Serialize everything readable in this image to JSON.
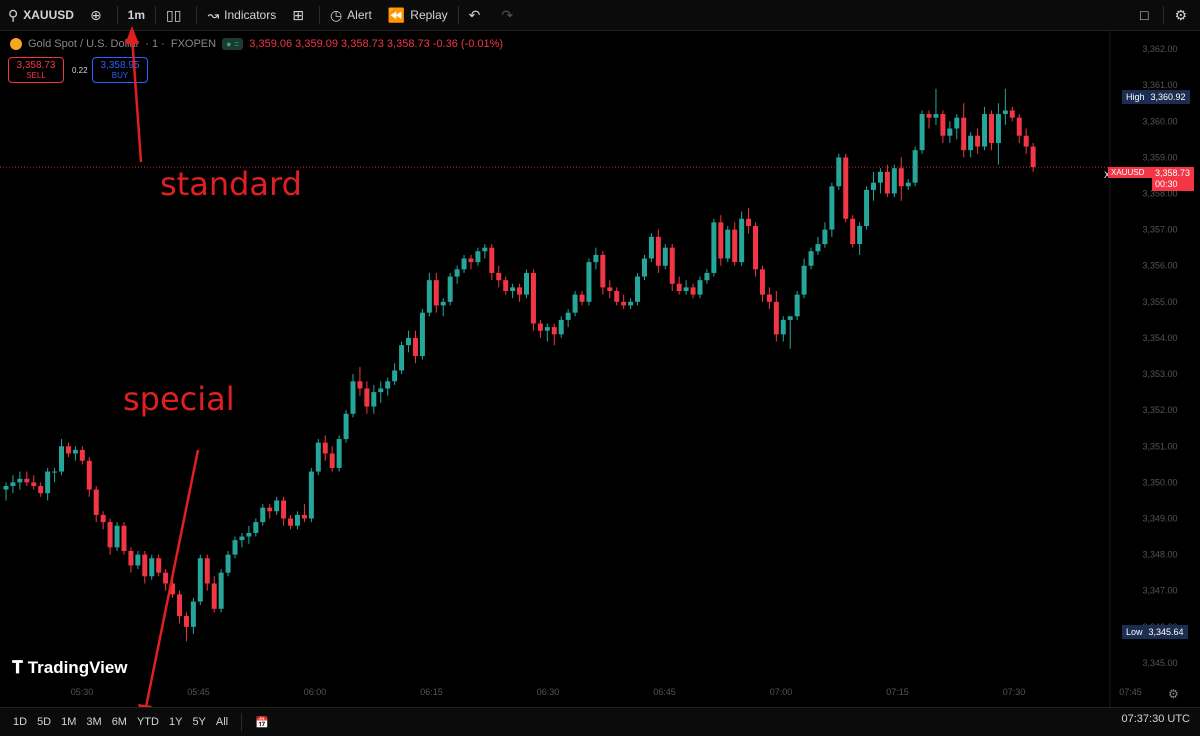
{
  "toolbar": {
    "symbol": "XAUUSD",
    "interval": "1m",
    "indicators": "Indicators",
    "alert": "Alert",
    "replay": "Replay"
  },
  "legend": {
    "title": "Gold Spot / U.S. Dollar",
    "separator": "· 1 ·",
    "broker": "FXOPEN",
    "ohlc": "3,359.06  3,359.09  3,358.73  3,358.73  -0.36 (-0.01%)"
  },
  "trade": {
    "sell_price": "3,358.73",
    "sell_label": "SELL",
    "spread": "0.22",
    "buy_price": "3,358.95",
    "buy_label": "BUY"
  },
  "price_labels": {
    "high_label": "High",
    "high_value": "3,360.92",
    "low_label": "Low",
    "low_value": "3,345.64",
    "symbol": "XAUUSD",
    "current": "3,358.73",
    "countdown": "00:30"
  },
  "annotations": {
    "standard": "standard",
    "special": "special"
  },
  "brand": "TradingView",
  "ranges": [
    "1D",
    "5D",
    "1M",
    "3M",
    "6M",
    "YTD",
    "1Y",
    "5Y",
    "All"
  ],
  "time_display": "07:37:30 UTC",
  "colors": {
    "up": "#26a69a",
    "down": "#f23645",
    "background": "#000000",
    "annotation": "#e02020"
  },
  "chart_data": {
    "type": "candlestick",
    "ylim": [
      3344.5,
      3362.5
    ],
    "y_ticks": [
      "3,362.00",
      "3,361.00",
      "3,360.00",
      "3,359.00",
      "3,358.00",
      "3,357.00",
      "3,356.00",
      "3,355.00",
      "3,354.00",
      "3,353.00",
      "3,352.00",
      "3,351.00",
      "3,350.00",
      "3,349.00",
      "3,348.00",
      "3,347.00",
      "3,346.00",
      "3,345.00"
    ],
    "y_tick_values": [
      3362,
      3361,
      3360,
      3359,
      3358,
      3357,
      3356,
      3355,
      3354,
      3353,
      3352,
      3351,
      3350,
      3349,
      3348,
      3347,
      3346,
      3345
    ],
    "x_ticks": [
      "05:30",
      "05:45",
      "06:00",
      "06:15",
      "06:30",
      "06:45",
      "07:00",
      "07:15",
      "07:30",
      "07:45"
    ],
    "current_price": 3358.73,
    "candles": [
      [
        3349.8,
        3350.0,
        3349.5,
        3349.9
      ],
      [
        3349.9,
        3350.2,
        3349.7,
        3350.0
      ],
      [
        3350.0,
        3350.3,
        3349.8,
        3350.1
      ],
      [
        3350.1,
        3350.3,
        3349.9,
        3350.0
      ],
      [
        3350.0,
        3350.2,
        3349.8,
        3349.9
      ],
      [
        3349.9,
        3350.0,
        3349.6,
        3349.7
      ],
      [
        3349.7,
        3350.4,
        3349.5,
        3350.3
      ],
      [
        3350.3,
        3350.4,
        3350.0,
        3350.3
      ],
      [
        3350.3,
        3351.2,
        3350.2,
        3351.0
      ],
      [
        3351.0,
        3351.1,
        3350.7,
        3350.8
      ],
      [
        3350.8,
        3351.0,
        3350.6,
        3350.9
      ],
      [
        3350.9,
        3351.0,
        3350.5,
        3350.6
      ],
      [
        3350.6,
        3350.7,
        3349.6,
        3349.8
      ],
      [
        3349.8,
        3349.9,
        3348.9,
        3349.1
      ],
      [
        3349.1,
        3349.2,
        3348.7,
        3348.9
      ],
      [
        3348.9,
        3349.0,
        3348.0,
        3348.2
      ],
      [
        3348.2,
        3348.9,
        3348.1,
        3348.8
      ],
      [
        3348.8,
        3348.9,
        3348.0,
        3348.1
      ],
      [
        3348.1,
        3348.2,
        3347.5,
        3347.7
      ],
      [
        3347.7,
        3348.1,
        3347.6,
        3348.0
      ],
      [
        3348.0,
        3348.1,
        3347.2,
        3347.4
      ],
      [
        3347.4,
        3348.0,
        3347.3,
        3347.9
      ],
      [
        3347.9,
        3348.0,
        3347.4,
        3347.5
      ],
      [
        3347.5,
        3347.6,
        3347.0,
        3347.2
      ],
      [
        3347.2,
        3347.4,
        3346.8,
        3346.9
      ],
      [
        3346.9,
        3347.0,
        3346.1,
        3346.3
      ],
      [
        3346.3,
        3346.4,
        3345.6,
        3346.0
      ],
      [
        3346.0,
        3346.8,
        3345.8,
        3346.7
      ],
      [
        3346.7,
        3348.0,
        3346.6,
        3347.9
      ],
      [
        3347.9,
        3348.0,
        3347.0,
        3347.2
      ],
      [
        3347.2,
        3347.4,
        3346.4,
        3346.5
      ],
      [
        3346.5,
        3347.6,
        3346.4,
        3347.5
      ],
      [
        3347.5,
        3348.1,
        3347.4,
        3348.0
      ],
      [
        3348.0,
        3348.5,
        3347.9,
        3348.4
      ],
      [
        3348.4,
        3348.6,
        3348.2,
        3348.5
      ],
      [
        3348.5,
        3348.8,
        3348.3,
        3348.6
      ],
      [
        3348.6,
        3349.0,
        3348.5,
        3348.9
      ],
      [
        3348.9,
        3349.4,
        3348.8,
        3349.3
      ],
      [
        3349.3,
        3349.4,
        3349.0,
        3349.2
      ],
      [
        3349.2,
        3349.6,
        3349.1,
        3349.5
      ],
      [
        3349.5,
        3349.6,
        3348.8,
        3349.0
      ],
      [
        3349.0,
        3349.1,
        3348.7,
        3348.8
      ],
      [
        3348.8,
        3349.2,
        3348.7,
        3349.1
      ],
      [
        3349.1,
        3349.4,
        3348.9,
        3349.0
      ],
      [
        3349.0,
        3350.4,
        3348.9,
        3350.3
      ],
      [
        3350.3,
        3351.2,
        3350.2,
        3351.1
      ],
      [
        3351.1,
        3351.3,
        3350.6,
        3350.8
      ],
      [
        3350.8,
        3351.0,
        3350.3,
        3350.4
      ],
      [
        3350.4,
        3351.3,
        3350.3,
        3351.2
      ],
      [
        3351.2,
        3352.0,
        3351.1,
        3351.9
      ],
      [
        3351.9,
        3353.0,
        3351.8,
        3352.8
      ],
      [
        3352.8,
        3353.2,
        3352.4,
        3352.6
      ],
      [
        3352.6,
        3352.8,
        3351.9,
        3352.1
      ],
      [
        3352.1,
        3352.7,
        3351.9,
        3352.5
      ],
      [
        3352.5,
        3352.8,
        3352.2,
        3352.6
      ],
      [
        3352.6,
        3352.9,
        3352.4,
        3352.8
      ],
      [
        3352.8,
        3353.3,
        3352.7,
        3353.1
      ],
      [
        3353.1,
        3353.9,
        3353.0,
        3353.8
      ],
      [
        3353.8,
        3354.2,
        3353.6,
        3354.0
      ],
      [
        3354.0,
        3354.2,
        3353.3,
        3353.5
      ],
      [
        3353.5,
        3354.8,
        3353.4,
        3354.7
      ],
      [
        3354.7,
        3355.8,
        3354.6,
        3355.6
      ],
      [
        3355.6,
        3355.8,
        3354.7,
        3354.9
      ],
      [
        3354.9,
        3355.1,
        3354.6,
        3355.0
      ],
      [
        3355.0,
        3355.8,
        3354.9,
        3355.7
      ],
      [
        3355.7,
        3356.0,
        3355.5,
        3355.9
      ],
      [
        3355.9,
        3356.3,
        3355.8,
        3356.2
      ],
      [
        3356.2,
        3356.3,
        3355.9,
        3356.1
      ],
      [
        3356.1,
        3356.5,
        3356.0,
        3356.4
      ],
      [
        3356.4,
        3356.6,
        3356.2,
        3356.5
      ],
      [
        3356.5,
        3356.6,
        3355.6,
        3355.8
      ],
      [
        3355.8,
        3356.0,
        3355.4,
        3355.6
      ],
      [
        3355.6,
        3355.7,
        3355.2,
        3355.3
      ],
      [
        3355.3,
        3355.5,
        3355.1,
        3355.4
      ],
      [
        3355.4,
        3355.5,
        3355.0,
        3355.2
      ],
      [
        3355.2,
        3355.9,
        3355.1,
        3355.8
      ],
      [
        3355.8,
        3355.9,
        3354.2,
        3354.4
      ],
      [
        3354.4,
        3354.5,
        3354.0,
        3354.2
      ],
      [
        3354.2,
        3354.4,
        3353.9,
        3354.3
      ],
      [
        3354.3,
        3354.4,
        3353.8,
        3354.1
      ],
      [
        3354.1,
        3354.6,
        3354.0,
        3354.5
      ],
      [
        3354.5,
        3354.8,
        3354.3,
        3354.7
      ],
      [
        3354.7,
        3355.3,
        3354.6,
        3355.2
      ],
      [
        3355.2,
        3355.3,
        3354.9,
        3355.0
      ],
      [
        3355.0,
        3356.2,
        3354.9,
        3356.1
      ],
      [
        3356.1,
        3356.5,
        3355.9,
        3356.3
      ],
      [
        3356.3,
        3356.4,
        3355.2,
        3355.4
      ],
      [
        3355.4,
        3355.6,
        3355.1,
        3355.3
      ],
      [
        3355.3,
        3355.4,
        3354.9,
        3355.0
      ],
      [
        3355.0,
        3355.2,
        3354.8,
        3354.9
      ],
      [
        3354.9,
        3355.1,
        3354.8,
        3355.0
      ],
      [
        3355.0,
        3355.8,
        3354.9,
        3355.7
      ],
      [
        3355.7,
        3356.3,
        3355.6,
        3356.2
      ],
      [
        3356.2,
        3356.9,
        3356.1,
        3356.8
      ],
      [
        3356.8,
        3357.0,
        3355.8,
        3356.0
      ],
      [
        3356.0,
        3356.6,
        3355.9,
        3356.5
      ],
      [
        3356.5,
        3356.6,
        3355.3,
        3355.5
      ],
      [
        3355.5,
        3355.7,
        3355.2,
        3355.3
      ],
      [
        3355.3,
        3355.6,
        3355.2,
        3355.4
      ],
      [
        3355.4,
        3355.5,
        3355.1,
        3355.2
      ],
      [
        3355.2,
        3355.7,
        3355.1,
        3355.6
      ],
      [
        3355.6,
        3355.9,
        3355.5,
        3355.8
      ],
      [
        3355.8,
        3357.3,
        3355.7,
        3357.2
      ],
      [
        3357.2,
        3357.4,
        3356.0,
        3356.2
      ],
      [
        3356.2,
        3357.1,
        3356.1,
        3357.0
      ],
      [
        3357.0,
        3357.2,
        3356.0,
        3356.1
      ],
      [
        3356.1,
        3357.5,
        3356.0,
        3357.3
      ],
      [
        3357.3,
        3357.6,
        3356.9,
        3357.1
      ],
      [
        3357.1,
        3357.2,
        3355.7,
        3355.9
      ],
      [
        3355.9,
        3356.0,
        3355.0,
        3355.2
      ],
      [
        3355.2,
        3355.4,
        3354.8,
        3355.0
      ],
      [
        3355.0,
        3355.3,
        3353.9,
        3354.1
      ],
      [
        3354.1,
        3354.6,
        3353.9,
        3354.5
      ],
      [
        3354.5,
        3354.6,
        3353.7,
        3354.6
      ],
      [
        3354.6,
        3355.3,
        3354.5,
        3355.2
      ],
      [
        3355.2,
        3356.2,
        3355.1,
        3356.0
      ],
      [
        3356.0,
        3356.5,
        3355.9,
        3356.4
      ],
      [
        3356.4,
        3356.8,
        3356.3,
        3356.6
      ],
      [
        3356.6,
        3357.2,
        3356.5,
        3357.0
      ],
      [
        3357.0,
        3358.3,
        3356.8,
        3358.2
      ],
      [
        3358.2,
        3359.1,
        3358.1,
        3359.0
      ],
      [
        3359.0,
        3359.1,
        3357.2,
        3357.3
      ],
      [
        3357.3,
        3357.4,
        3356.5,
        3356.6
      ],
      [
        3356.6,
        3357.2,
        3356.3,
        3357.1
      ],
      [
        3357.1,
        3358.2,
        3357.0,
        3358.1
      ],
      [
        3358.1,
        3358.6,
        3357.8,
        3358.3
      ],
      [
        3358.3,
        3358.7,
        3358.0,
        3358.6
      ],
      [
        3358.6,
        3358.8,
        3357.9,
        3358.0
      ],
      [
        3358.0,
        3358.8,
        3357.9,
        3358.7
      ],
      [
        3358.7,
        3359.0,
        3357.8,
        3358.2
      ],
      [
        3358.2,
        3358.4,
        3358.1,
        3358.3
      ],
      [
        3358.3,
        3359.3,
        3358.2,
        3359.2
      ],
      [
        3359.2,
        3360.3,
        3359.1,
        3360.2
      ],
      [
        3360.2,
        3360.3,
        3359.8,
        3360.1
      ],
      [
        3360.1,
        3360.9,
        3359.9,
        3360.2
      ],
      [
        3360.2,
        3360.3,
        3359.4,
        3359.6
      ],
      [
        3359.6,
        3360.0,
        3359.4,
        3359.8
      ],
      [
        3359.8,
        3360.2,
        3359.5,
        3360.1
      ],
      [
        3360.1,
        3360.5,
        3359.0,
        3359.2
      ],
      [
        3359.2,
        3359.7,
        3359.0,
        3359.6
      ],
      [
        3359.6,
        3359.8,
        3359.1,
        3359.3
      ],
      [
        3359.3,
        3360.4,
        3359.2,
        3360.2
      ],
      [
        3360.2,
        3360.3,
        3359.2,
        3359.4
      ],
      [
        3359.4,
        3360.5,
        3358.8,
        3360.2
      ],
      [
        3360.2,
        3360.9,
        3359.9,
        3360.3
      ],
      [
        3360.3,
        3360.4,
        3360.0,
        3360.1
      ],
      [
        3360.1,
        3360.2,
        3359.4,
        3359.6
      ],
      [
        3359.6,
        3359.8,
        3359.1,
        3359.3
      ],
      [
        3359.3,
        3359.4,
        3358.6,
        3358.73
      ]
    ]
  }
}
